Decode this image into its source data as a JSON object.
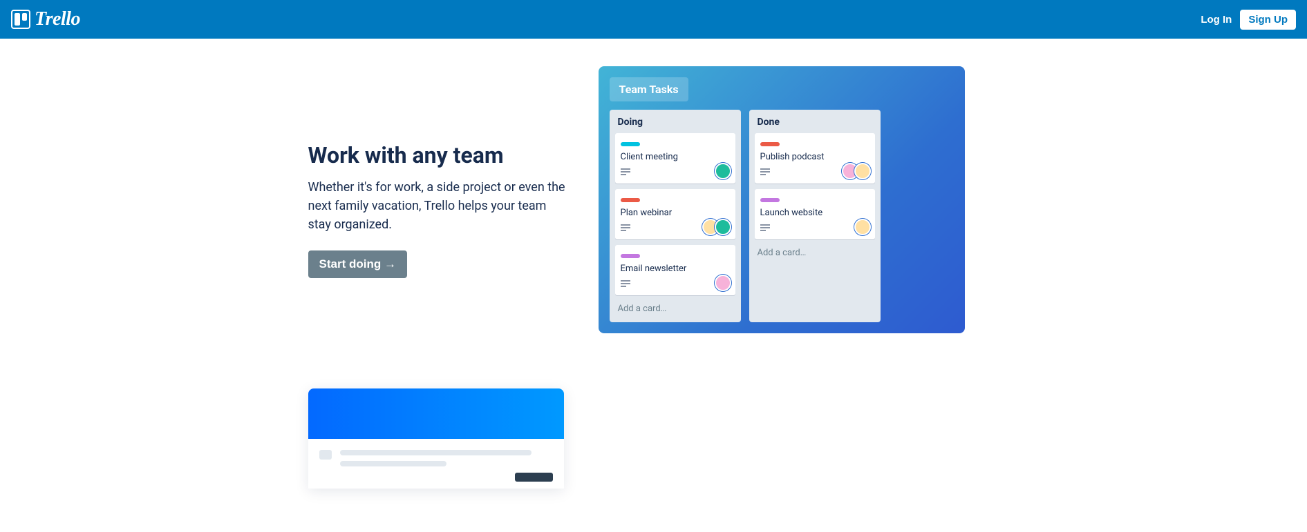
{
  "header": {
    "brand": "Trello",
    "login": "Log In",
    "signup": "Sign Up"
  },
  "hero": {
    "heading": "Work with any team",
    "body": "Whether it's for work, a side project or even the next family vacation, Trello helps your team stay organized.",
    "cta": "Start doing →"
  },
  "board": {
    "title": "Team Tasks",
    "addCard": "Add a card…",
    "lists": [
      {
        "name": "Doing",
        "cards": [
          {
            "label": "teal",
            "title": "Client meeting",
            "avatars": [
              "av1"
            ]
          },
          {
            "label": "red",
            "title": "Plan webinar",
            "avatars": [
              "av3",
              "av1"
            ]
          },
          {
            "label": "purple",
            "title": "Email newsletter",
            "avatars": [
              "av2"
            ]
          }
        ]
      },
      {
        "name": "Done",
        "cards": [
          {
            "label": "red",
            "title": "Publish podcast",
            "avatars": [
              "av2",
              "av3"
            ]
          },
          {
            "label": "purple",
            "title": "Launch website",
            "avatars": [
              "av3"
            ]
          }
        ]
      }
    ]
  }
}
